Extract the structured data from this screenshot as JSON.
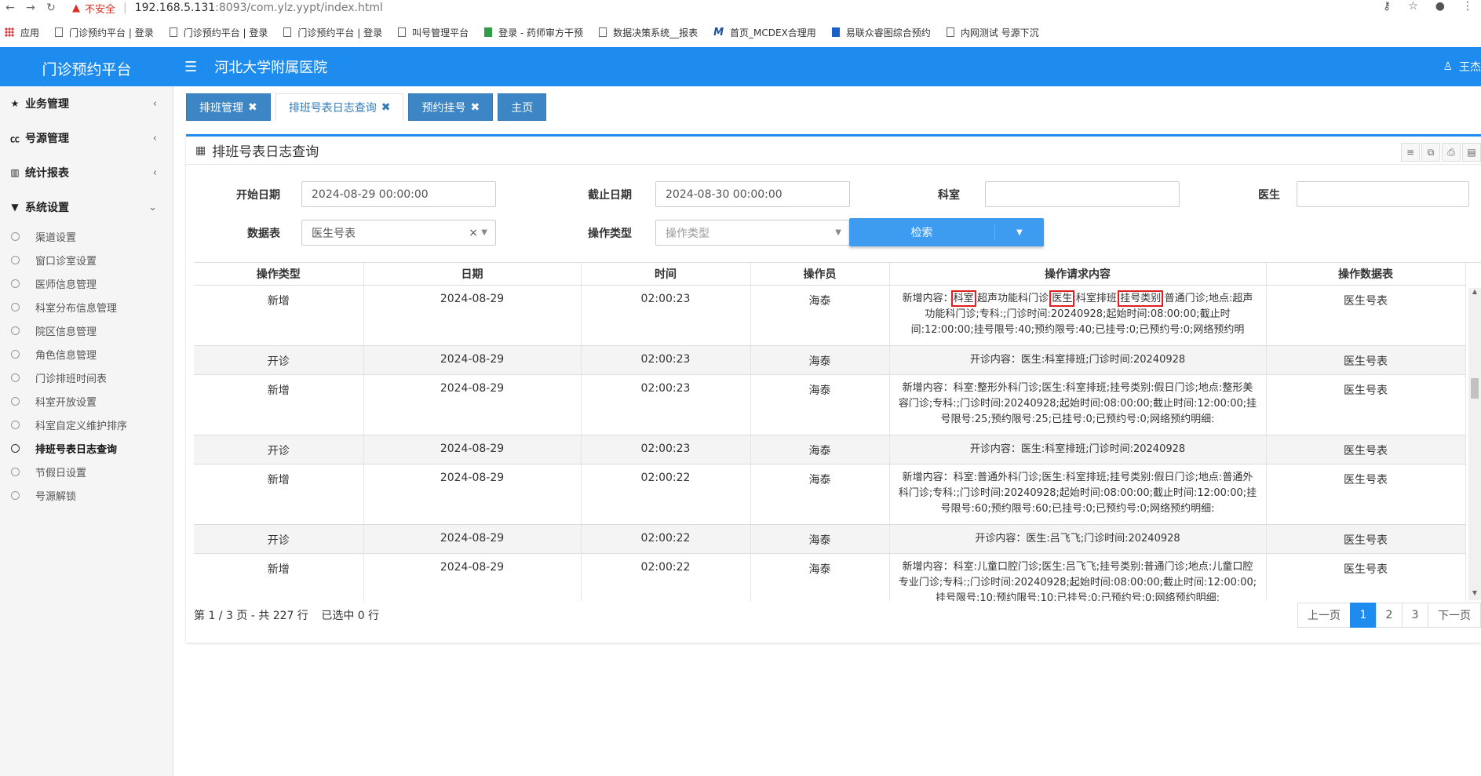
{
  "browser": {
    "insecure_label": "不安全",
    "url_host": "192.168.5.131",
    "url_rest": ":8093/com.ylz.yypt/index.html",
    "bookmarks": [
      {
        "label": "应用",
        "icon": "apps-grid-icon"
      },
      {
        "label": "门诊预约平台 | 登录",
        "icon": "page-icon"
      },
      {
        "label": "门诊预约平台 | 登录",
        "icon": "page-icon"
      },
      {
        "label": "门诊预约平台 | 登录",
        "icon": "page-icon"
      },
      {
        "label": "叫号管理平台",
        "icon": "page-icon"
      },
      {
        "label": "登录 - 药师审方干预",
        "icon": "green-r-icon"
      },
      {
        "label": "数据决策系统__报表",
        "icon": "page-icon"
      },
      {
        "label": "首页_MCDEX合理用",
        "icon": "m-icon"
      },
      {
        "label": "易联众睿图综合预约",
        "icon": "blue-app-icon"
      },
      {
        "label": "内网测试 号源下沉",
        "icon": "page-icon"
      }
    ]
  },
  "header": {
    "app_title": "门诊预约平台",
    "hospital": "河北大学附属医院",
    "user": "王杰"
  },
  "sidebar": {
    "menus": [
      {
        "label": "业务管理",
        "icon": "star-icon"
      },
      {
        "label": "号源管理",
        "icon": "cc-icon"
      },
      {
        "label": "统计报表",
        "icon": "bar-chart-icon"
      },
      {
        "label": "系统设置",
        "icon": "filter-icon"
      }
    ],
    "sub_items": [
      "渠道设置",
      "窗口诊室设置",
      "医师信息管理",
      "科室分布信息管理",
      "院区信息管理",
      "角色信息管理",
      "门诊排班时间表",
      "科室开放设置",
      "科室自定义维护排序",
      "排班号表日志查询",
      "节假日设置",
      "号源解锁"
    ],
    "active_sub": "排班号表日志查询"
  },
  "tabs": [
    {
      "label": "排班管理"
    },
    {
      "label": "排班号表日志查询"
    },
    {
      "label": "预约挂号"
    },
    {
      "label": "主页"
    }
  ],
  "panel": {
    "title": "排班号表日志查询"
  },
  "form": {
    "start_label": "开始日期",
    "start_value": "2024-08-29 00:00:00",
    "end_label": "截止日期",
    "end_value": "2024-08-30 00:00:00",
    "dept_label": "科室",
    "dept_value": "",
    "doctor_label": "医生",
    "doctor_value": "",
    "table_label": "数据表",
    "table_value": "医生号表",
    "optype_label": "操作类型",
    "optype_placeholder": "操作类型",
    "search_label": "检索"
  },
  "table": {
    "headers": [
      "操作类型",
      "日期",
      "时间",
      "操作员",
      "操作请求内容",
      "操作数据表"
    ],
    "rows": [
      {
        "type": "新增",
        "date": "2024-08-29",
        "time": "02:00:23",
        "op": "海泰",
        "table": "医生号表",
        "c1": "新增内容：",
        "c2": "科室",
        "c3": ":超声功能科门诊;",
        "c4": "医生",
        "c5": ":科室排班;",
        "c6": "挂号类别",
        "c7": ":普通门诊;地点:超声功能科门诊;专科:;门诊时间:20240928;起始时间:08:00:00;截止时间:12:00:00;挂号限号:40;预约限号:40;已挂号:0;已预约号:0;网络预约明"
      },
      {
        "type": "开诊",
        "date": "2024-08-29",
        "time": "02:00:23",
        "op": "海泰",
        "table": "医生号表",
        "content": "开诊内容：医生:科室排班;门诊时间:20240928"
      },
      {
        "type": "新增",
        "date": "2024-08-29",
        "time": "02:00:23",
        "op": "海泰",
        "table": "医生号表",
        "content": "新增内容：科室:整形外科门诊;医生:科室排班;挂号类别:假日门诊;地点:整形美容门诊;专科:;门诊时间:20240928;起始时间:08:00:00;截止时间:12:00:00;挂号限号:25;预约限号:25;已挂号:0;已预约号:0;网络预约明细:"
      },
      {
        "type": "开诊",
        "date": "2024-08-29",
        "time": "02:00:23",
        "op": "海泰",
        "table": "医生号表",
        "content": "开诊内容：医生:科室排班;门诊时间:20240928"
      },
      {
        "type": "新增",
        "date": "2024-08-29",
        "time": "02:00:22",
        "op": "海泰",
        "table": "医生号表",
        "content": "新增内容：科室:普通外科门诊;医生:科室排班;挂号类别:假日门诊;地点:普通外科门诊;专科:;门诊时间:20240928;起始时间:08:00:00;截止时间:12:00:00;挂号限号:60;预约限号:60;已挂号:0;已预约号:0;网络预约明细:"
      },
      {
        "type": "开诊",
        "date": "2024-08-29",
        "time": "02:00:22",
        "op": "海泰",
        "table": "医生号表",
        "content": "开诊内容：医生:吕飞飞;门诊时间:20240928"
      },
      {
        "type": "新增",
        "date": "2024-08-29",
        "time": "02:00:22",
        "op": "海泰",
        "table": "医生号表",
        "content": "新增内容：科室:儿童口腔门诊;医生:吕飞飞;挂号类别:普通门诊;地点:儿童口腔专业门诊;专科:;门诊时间:20240928;起始时间:08:00:00;截止时间:12:00:00;挂号限号:10;预约限号:10;已挂号:0;已预约号:0;网络预约明细:"
      }
    ]
  },
  "pager": {
    "info": "第 1 / 3 页 - 共 227 行",
    "selected": "已选中 0 行",
    "prev": "上一页",
    "pages": [
      "1",
      "2",
      "3"
    ],
    "next": "下一页"
  },
  "colors": {
    "accent": "#1e8bef",
    "tab": "#3d86c6",
    "highlight": "#e02020"
  }
}
